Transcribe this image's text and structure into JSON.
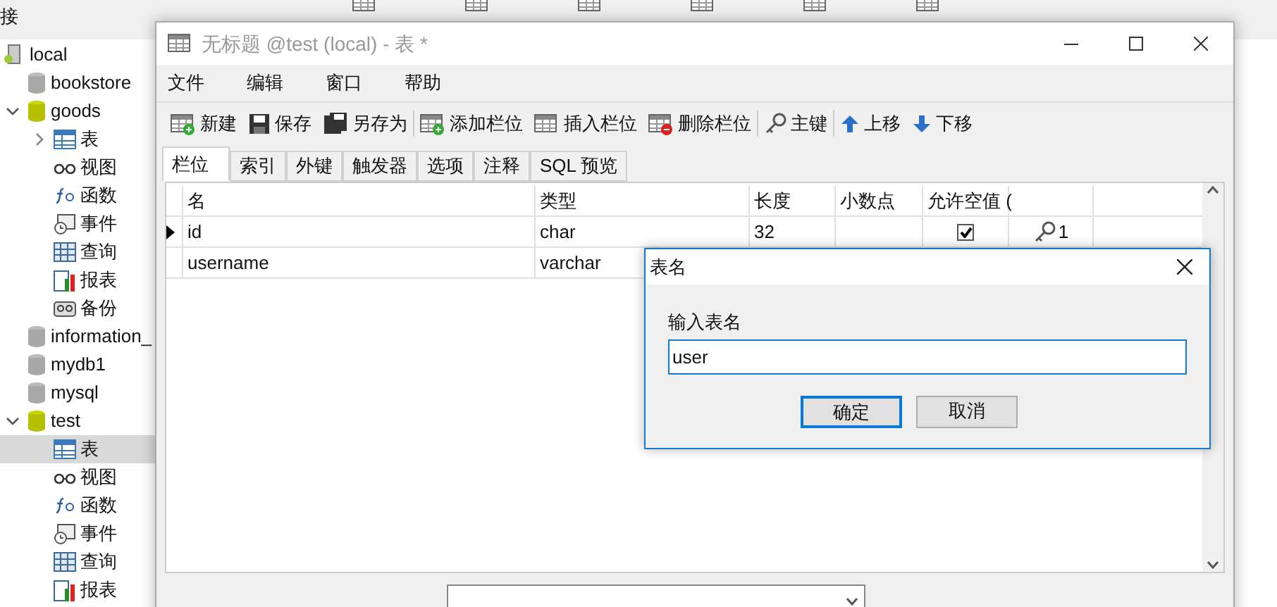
{
  "app": {
    "header": "接"
  },
  "tree": [
    {
      "kind": "server",
      "label": "local",
      "children": [
        {
          "kind": "db",
          "label": "bookstore",
          "open": false
        },
        {
          "kind": "db",
          "label": "goods",
          "open": true,
          "expanded": true,
          "children": [
            {
              "kind": "table",
              "label": "表",
              "expanded": false,
              "selected": false
            },
            {
              "kind": "view",
              "label": "视图",
              "selected": false
            },
            {
              "kind": "function",
              "label": "函数",
              "selected": false
            },
            {
              "kind": "event",
              "label": "事件",
              "selected": false
            },
            {
              "kind": "query",
              "label": "查询",
              "selected": false
            },
            {
              "kind": "report",
              "label": "报表",
              "selected": false
            },
            {
              "kind": "backup",
              "label": "备份",
              "selected": false
            }
          ]
        },
        {
          "kind": "db",
          "label": "information_",
          "open": false
        },
        {
          "kind": "db",
          "label": "mydb1",
          "open": false
        },
        {
          "kind": "db",
          "label": "mysql",
          "open": false
        },
        {
          "kind": "db",
          "label": "test",
          "open": true,
          "expanded": true,
          "children": [
            {
              "kind": "table",
              "label": "表",
              "selected": true
            },
            {
              "kind": "view",
              "label": "视图",
              "selected": false
            },
            {
              "kind": "function",
              "label": "函数",
              "selected": false
            },
            {
              "kind": "event",
              "label": "事件",
              "selected": false
            },
            {
              "kind": "query",
              "label": "查询",
              "selected": false
            },
            {
              "kind": "report",
              "label": "报表",
              "selected": false
            }
          ]
        }
      ]
    }
  ],
  "window": {
    "title": "无标题 @test (local) - 表 *",
    "menu": [
      "文件",
      "编辑",
      "窗口",
      "帮助"
    ],
    "toolbar": [
      [
        {
          "kind": "new",
          "label": "新建"
        },
        {
          "kind": "save",
          "label": "保存"
        },
        {
          "kind": "saveas",
          "label": "另存为"
        }
      ],
      [
        {
          "kind": "addcol",
          "label": "添加栏位"
        },
        {
          "kind": "insertcol",
          "label": "插入栏位"
        },
        {
          "kind": "deletecol",
          "label": "删除栏位"
        }
      ],
      [
        {
          "kind": "key",
          "label": "主键"
        }
      ],
      [
        {
          "kind": "up",
          "label": "上移"
        },
        {
          "kind": "down",
          "label": "下移"
        }
      ]
    ],
    "tabs": [
      {
        "label": "栏位",
        "selected": true
      },
      {
        "label": "索引",
        "selected": false
      },
      {
        "label": "外键",
        "selected": false
      },
      {
        "label": "触发器",
        "selected": false
      },
      {
        "label": "选项",
        "selected": false
      },
      {
        "label": "注释",
        "selected": false
      },
      {
        "label": "SQL 预览",
        "selected": false
      }
    ],
    "table": {
      "columns": [
        "名",
        "类型",
        "长度",
        "小数点",
        "允许空值 ("
      ],
      "rows": [
        {
          "current": true,
          "name": "id",
          "type": "char",
          "length": "32",
          "decimals": "",
          "nullable_checked": true,
          "key": "1"
        },
        {
          "current": false,
          "name": "username",
          "type": "varchar"
        }
      ]
    }
  },
  "dialog": {
    "title": "表名",
    "label": "输入表名",
    "value": "user",
    "buttons": [
      {
        "label": "确定",
        "default": true
      },
      {
        "label": "取消",
        "default": false
      }
    ]
  }
}
